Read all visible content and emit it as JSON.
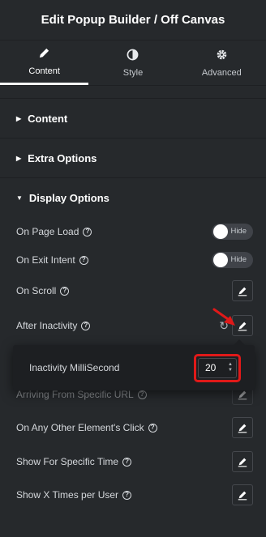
{
  "header": {
    "title": "Edit Popup Builder / Off Canvas"
  },
  "tabs": [
    {
      "label": "Content",
      "icon": "pencil-icon"
    },
    {
      "label": "Style",
      "icon": "contrast-icon"
    },
    {
      "label": "Advanced",
      "icon": "gear-icon"
    }
  ],
  "sections": {
    "content": "Content",
    "extra": "Extra Options",
    "display": "Display Options"
  },
  "rows": {
    "page_load": {
      "label": "On Page Load",
      "toggle": "Hide"
    },
    "exit_intent": {
      "label": "On Exit Intent",
      "toggle": "Hide"
    },
    "scroll": {
      "label": "On Scroll"
    },
    "inactivity": {
      "label": "After Inactivity"
    },
    "url": {
      "label": "Arriving From Specific URL"
    },
    "click": {
      "label": "On Any Other Element's Click"
    },
    "time": {
      "label": "Show For Specific Time"
    },
    "times_user": {
      "label": "Show X Times per User"
    }
  },
  "popover": {
    "label": "Inactivity MilliSecond",
    "value": "20"
  },
  "colors": {
    "background": "#26292c",
    "highlight": "#e01919",
    "popover": "#1d1f22"
  }
}
